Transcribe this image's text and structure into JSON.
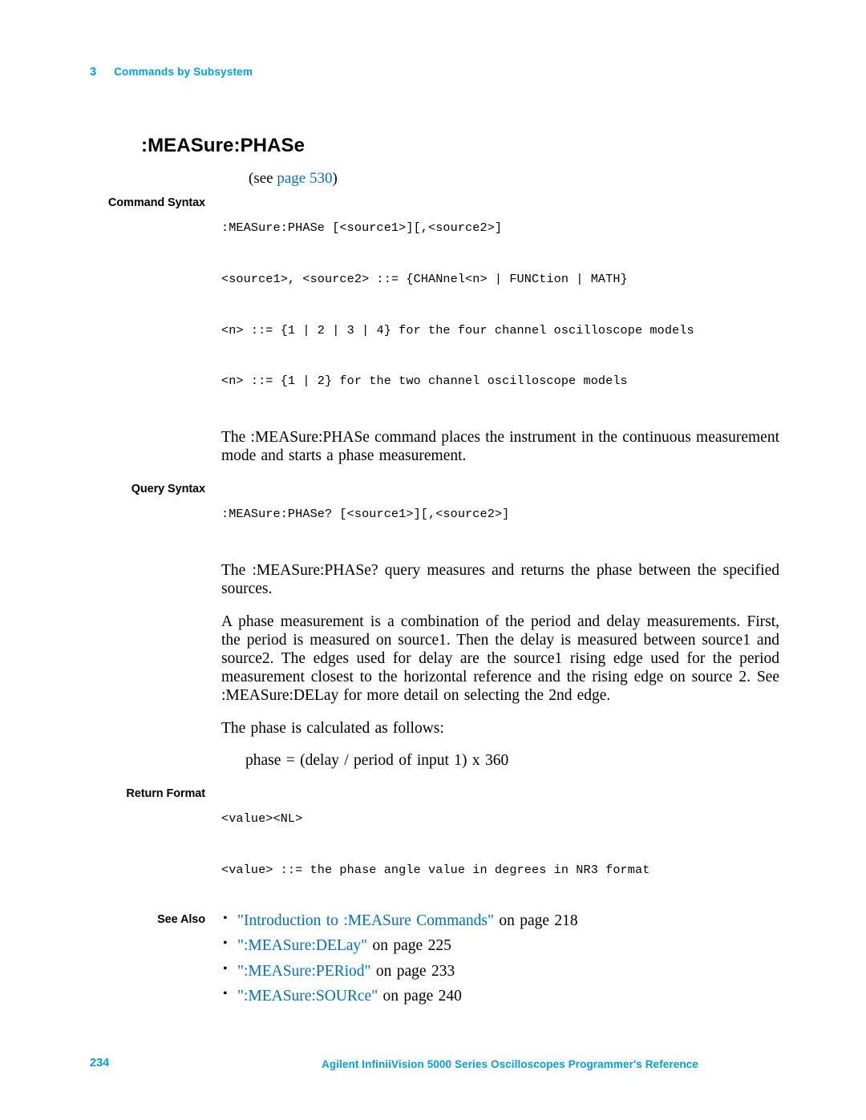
{
  "header": {
    "chapter_number": "3",
    "chapter_title": "Commands by Subsystem"
  },
  "command": {
    "title": ":MEASure:PHASe",
    "see_prefix": "(see ",
    "see_link": "page",
    "see_page": "530",
    "see_suffix": ")"
  },
  "labels": {
    "command_syntax": "Command Syntax",
    "query_syntax": "Query Syntax",
    "return_format": "Return Format",
    "see_also": "See Also"
  },
  "command_syntax": {
    "line1": ":MEASure:PHASe [<source1>][,<source2>]",
    "line2": "<source1>, <source2> ::= {CHANnel<n> | FUNCtion | MATH}",
    "line3": "<n> ::= {1 | 2 | 3 | 4} for the four channel oscilloscope models",
    "line4": "<n> ::= {1 | 2} for the two channel oscilloscope models",
    "description": "The :MEASure:PHASe command places the instrument in the continuous measurement mode and starts a phase measurement."
  },
  "query_syntax": {
    "line1": ":MEASure:PHASe? [<source1>][,<source2>]",
    "description": "The :MEASure:PHASe? query measures and returns the phase between the specified sources.",
    "paragraph2": "A phase measurement is a combination of the period and delay measurements. First, the period is measured on source1. Then the delay is measured between source1 and source2. The edges used for delay are the source1 rising edge used for the period measurement closest to the horizontal reference and the rising edge on source 2. See :MEASure:DELay for more detail on selecting the 2nd edge.",
    "paragraph3": "The phase is calculated as follows:",
    "equation": "phase = (delay / period of input 1) x 360"
  },
  "return_format": {
    "line1": "<value><NL>",
    "line2": "<value> ::= the phase angle value in degrees in NR3 format"
  },
  "see_also": [
    {
      "link": "\"Introduction to :MEASure Commands\"",
      "tail": " on page 218"
    },
    {
      "link": "\":MEASure:DELay\"",
      "tail": " on page 225"
    },
    {
      "link": "\":MEASure:PERiod\"",
      "tail": " on page 233"
    },
    {
      "link": "\":MEASure:SOURce\"",
      "tail": " on page 240"
    }
  ],
  "footer": {
    "page_number": "234",
    "title": "Agilent InfiniiVision 5000 Series Oscilloscopes Programmer's Reference"
  },
  "colors": {
    "accent": "#009fdf",
    "link": "#0070c0"
  }
}
